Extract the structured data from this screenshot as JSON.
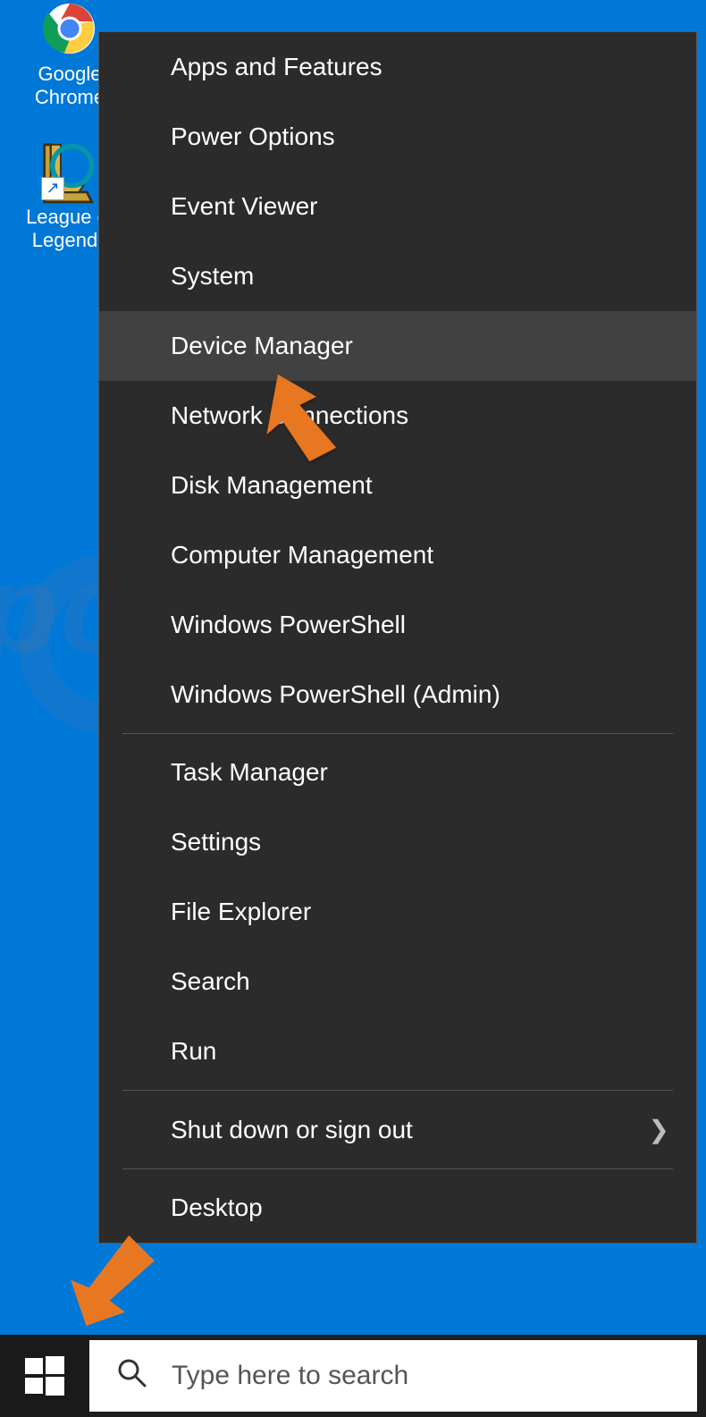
{
  "desktop": {
    "icons": [
      {
        "label": "Google Chrome",
        "name": "chrome"
      },
      {
        "label": "League of Legends",
        "name": "league-of-legends"
      }
    ]
  },
  "context_menu": {
    "groups": [
      {
        "items": [
          "Apps and Features",
          "Power Options",
          "Event Viewer",
          "System",
          "Device Manager",
          "Network Connections",
          "Disk Management",
          "Computer Management",
          "Windows PowerShell",
          "Windows PowerShell (Admin)"
        ]
      },
      {
        "items": [
          "Task Manager",
          "Settings",
          "File Explorer",
          "Search",
          "Run"
        ]
      },
      {
        "items": [
          "Shut down or sign out"
        ],
        "has_submenu": [
          true
        ]
      },
      {
        "items": [
          "Desktop"
        ]
      }
    ],
    "hovered": "Device Manager"
  },
  "taskbar": {
    "search_placeholder": "Type here to search"
  },
  "annotations": {
    "arrow_to_device_manager": true,
    "arrow_to_start": true
  },
  "watermark": "pcrisk.com"
}
